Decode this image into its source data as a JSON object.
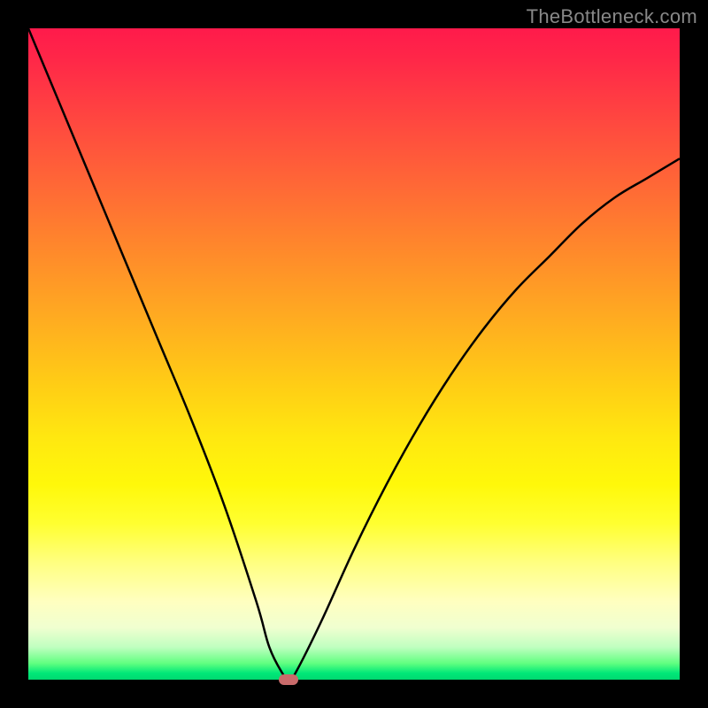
{
  "watermark": "TheBottleneck.com",
  "chart_data": {
    "type": "line",
    "title": "",
    "xlabel": "",
    "ylabel": "",
    "xlim": [
      0,
      100
    ],
    "ylim": [
      0,
      100
    ],
    "x": [
      0,
      5,
      10,
      15,
      20,
      25,
      30,
      35,
      37,
      39,
      40,
      41,
      45,
      50,
      55,
      60,
      65,
      70,
      75,
      80,
      85,
      90,
      95,
      100
    ],
    "values": [
      100,
      88,
      76,
      64,
      52,
      40,
      27,
      12,
      5,
      1,
      0,
      1,
      9,
      20,
      30,
      39,
      47,
      54,
      60,
      65,
      70,
      74,
      77,
      80
    ],
    "marker": {
      "x": 40,
      "y": 0
    },
    "gradient_stops": [
      {
        "pos": 0,
        "color": "#ff1a4b"
      },
      {
        "pos": 50,
        "color": "#ffce15"
      },
      {
        "pos": 80,
        "color": "#ffff60"
      },
      {
        "pos": 100,
        "color": "#00d870"
      }
    ]
  }
}
